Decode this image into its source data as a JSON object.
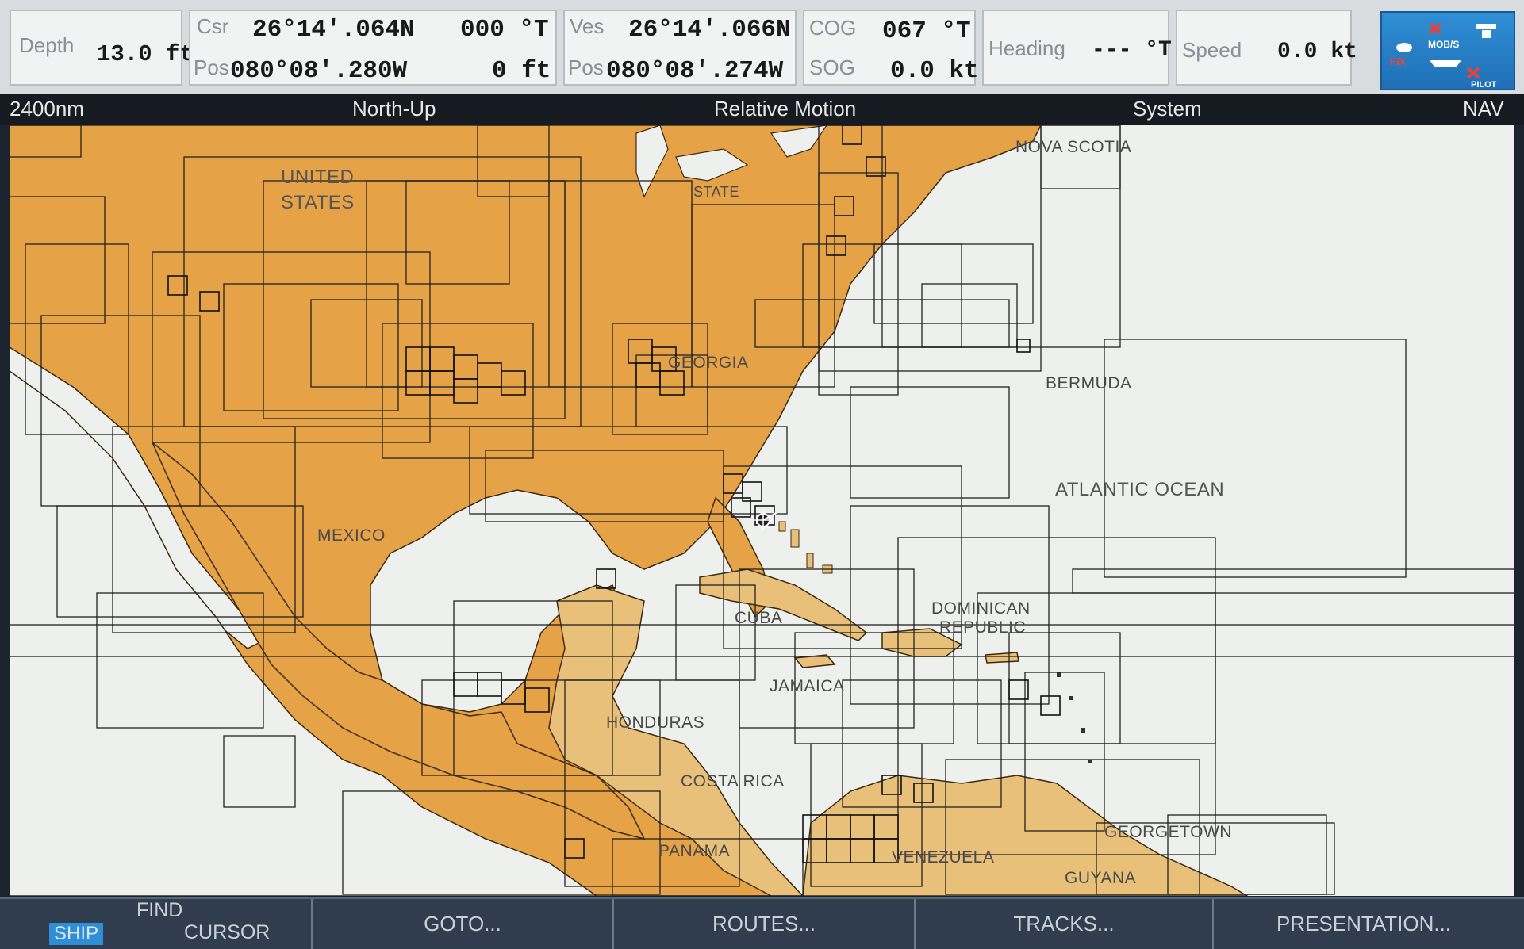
{
  "databar": {
    "depth": {
      "label": "Depth",
      "value": "13.0 ft"
    },
    "cursor": {
      "csr_label": "Csr",
      "lat": "26°14'.064N",
      "bearing": "000 °T",
      "pos_label": "Pos",
      "lon": "080°08'.280W",
      "range": "0 ft"
    },
    "vessel": {
      "ves_label": "Ves",
      "lat": "26°14'.066N",
      "pos_label": "Pos",
      "lon": "080°08'.274W"
    },
    "cog": {
      "label": "COG",
      "value": "067 °T"
    },
    "sog": {
      "label": "SOG",
      "value": "0.0 kt"
    },
    "heading": {
      "label": "Heading",
      "value": "--- °T"
    },
    "speed": {
      "label": "Speed",
      "value": "0.0 kt"
    },
    "fix_button": {
      "icon": "fix-mob-icon",
      "fix_text": "FIX",
      "mob_text": "MOB/S",
      "pilot_text": "PILOT"
    }
  },
  "statusbar": {
    "range": "2400nm",
    "orientation": "North-Up",
    "motion": "Relative Motion",
    "system": "System",
    "mode": "NAV"
  },
  "map": {
    "labels": {
      "united": "UNITED",
      "states": "STATES",
      "nova_scotia": "NOVA SCOTIA",
      "bermuda": "BERMUDA",
      "georgia": "GEORGIA",
      "atlantic": "ATLANTIC OCEAN",
      "mexico": "MEXICO",
      "cuba": "CUBA",
      "dominican": "DOMINICAN",
      "republic": "REPUBLIC",
      "jamaica": "JAMAICA",
      "honduras": "HONDURAS",
      "costa_rica": "COSTA RICA",
      "panama": "PANAMA",
      "venezuela": "VENEZUELA",
      "georgetown": "GEORGETOWN",
      "guyana": "GUYANA",
      "state": "STATE"
    },
    "colors": {
      "land_north": "#e6a246",
      "land_south": "#e8c07a",
      "sea": "#eef0ee",
      "grid": "#222222"
    }
  },
  "softkeys": {
    "ship_find": "FIND",
    "ship": "SHIP",
    "cursor": "CURSOR",
    "goto": "GOTO...",
    "routes": "ROUTES...",
    "tracks": "TRACKS...",
    "presentation": "PRESENTATION..."
  }
}
